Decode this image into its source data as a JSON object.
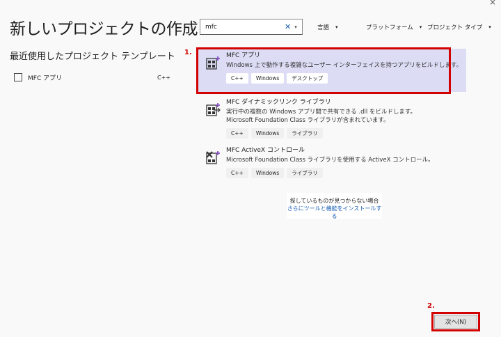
{
  "window": {
    "close_glyph": "×"
  },
  "header": {
    "title": "新しいプロジェクトの作成"
  },
  "recent": {
    "heading": "最近使用したプロジェクト テンプレート",
    "items": [
      {
        "name": "MFC アプリ",
        "lang": "C++",
        "icon": "mfc-icon"
      }
    ]
  },
  "search": {
    "value": "mfc",
    "placeholder": "",
    "clear_icon": "✕",
    "dropdown_icon": "▾"
  },
  "filters": {
    "language": "言語",
    "platform": "プラットフォーム",
    "project_type": "プロジェクト タイプ",
    "caret": "▾"
  },
  "templates": [
    {
      "name": "MFC アプリ",
      "description": "Windows 上で動作する複雑なユーザー インターフェイスを持つアプリをビルドします。",
      "tags": [
        "C++",
        "Windows",
        "デスクトップ"
      ],
      "selected": true
    },
    {
      "name": "MFC ダイナミックリンク ライブラリ",
      "description": "実行中の複数の Windows アプリ間で共有できる .dll をビルドします。",
      "description2": "Microsoft Foundation Class ライブラリが含まれています。",
      "tags": [
        "C++",
        "Windows",
        "ライブラリ"
      ],
      "selected": false
    },
    {
      "name": "MFC ActiveX コントロール",
      "description": "Microsoft Foundation Class ライブラリを使用する ActiveX コントロール。",
      "tags": [
        "C++",
        "Windows",
        "ライブラリ"
      ],
      "selected": false
    }
  ],
  "not_found": {
    "text": "探しているものが見つからない場合",
    "link": "さらにツールと機能をインストールする"
  },
  "annotations": {
    "step1": "1.",
    "step2": "2."
  },
  "footer": {
    "next_label": "次へ(N)"
  },
  "colors": {
    "highlight": "#d30000",
    "selected_bg": "#dcdcf5",
    "link": "#1a5fb4"
  }
}
